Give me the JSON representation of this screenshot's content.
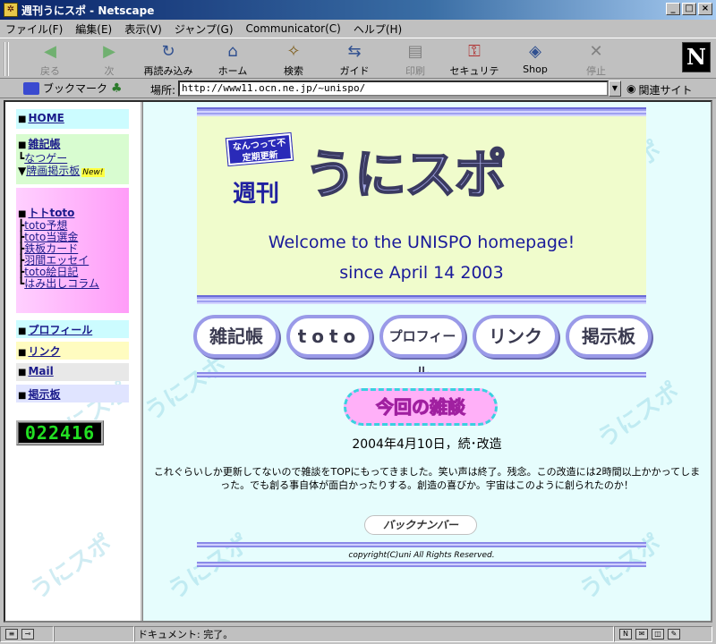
{
  "window": {
    "title": "週刊うにスポ - Netscape",
    "controls": {
      "minimize": "_",
      "maximize": "□",
      "close": "×"
    }
  },
  "menubar": [
    "ファイル(F)",
    "編集(E)",
    "表示(V)",
    "ジャンプ(G)",
    "Communicator(C)",
    "ヘルプ(H)"
  ],
  "toolbar": [
    {
      "label": "戻る",
      "icon": "back-arrow-icon",
      "glyph": "◀",
      "disabled": true
    },
    {
      "label": "次",
      "icon": "forward-arrow-icon",
      "glyph": "▶",
      "disabled": true
    },
    {
      "label": "再読み込み",
      "icon": "reload-icon",
      "glyph": "↻",
      "disabled": false
    },
    {
      "label": "ホーム",
      "icon": "home-icon",
      "glyph": "⌂",
      "disabled": false
    },
    {
      "label": "検索",
      "icon": "search-icon",
      "glyph": "✧",
      "disabled": false
    },
    {
      "label": "ガイド",
      "icon": "guide-icon",
      "glyph": "⇆",
      "disabled": false
    },
    {
      "label": "印刷",
      "icon": "print-icon",
      "glyph": "▤",
      "disabled": true
    },
    {
      "label": "セキュリティ",
      "icon": "lock-icon",
      "glyph": "⚿",
      "disabled": false
    },
    {
      "label": "Shop",
      "icon": "shop-icon",
      "glyph": "◈",
      "disabled": false
    },
    {
      "label": "停止",
      "icon": "stop-icon",
      "glyph": "✕",
      "disabled": true
    }
  ],
  "logo": "N",
  "location": {
    "bookmarks_label": "ブックマーク",
    "label": "場所:",
    "url": "http://www11.ocn.ne.jp/~unispo/",
    "related_label": "関連サイト"
  },
  "sidebar": {
    "home": "HOME",
    "zakki": "雑記帳",
    "natsuge": "なつゲー",
    "bbs_new": "牌画掲示板",
    "new_badge": "New!",
    "toto": "トトtoto",
    "toto_items": [
      "toto予想",
      "toto当選金",
      "鉄板カード",
      "羽間エッセイ",
      "toto絵日記",
      "はみ出しコラム"
    ],
    "profile": "プロフィール",
    "link": "リンク",
    "mail": "Mail",
    "board": "掲示板",
    "counter": "022416"
  },
  "header": {
    "tagline": "なんつって不定期更新",
    "shuukan": "週刊",
    "logo_text": "うにスポ",
    "welcome": "Welcome to the UNISPO homepage!",
    "since": "since April 14 2003"
  },
  "nav_buttons": [
    "雑記帳",
    "toto",
    "プロフィール",
    "リンク",
    "掲示板"
  ],
  "news": {
    "badge": "今回の雑談",
    "date": "2004年4月10日，続･改造",
    "body": "これぐらいしか更新してないので雑談をTOPにもってきました。笑い声は終了。残念。この改造には2時間以上かかってしまった。でも創る事自体が面白かったりする。創造の喜びか。宇宙はこのように創られたのか！"
  },
  "back_number": "バックナンバー",
  "copyright": "copyright(C)uni All Rights Reserved.",
  "status": {
    "text": "ドキュメント: 完了。"
  },
  "watermark": "うにスポ",
  "colors": {
    "page_bg": "#e6fdfd",
    "title_bar": "#0a246a",
    "welcome_text": "#1a1a9a",
    "pill_border": "#9a9ae8"
  }
}
